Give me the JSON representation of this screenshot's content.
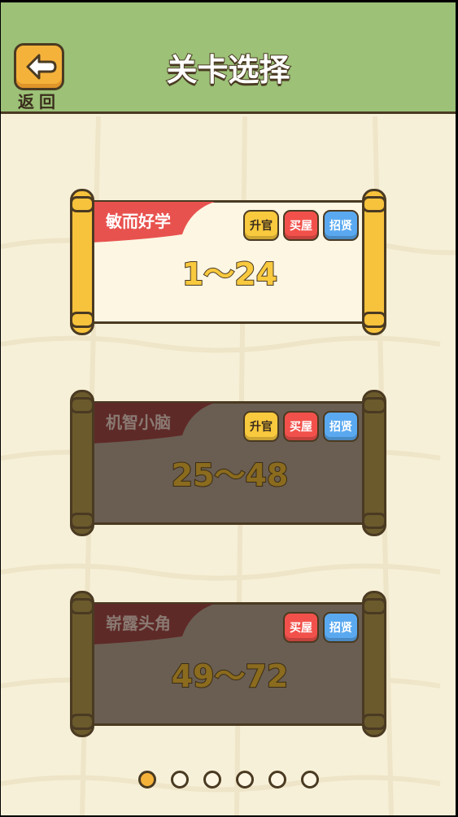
{
  "header": {
    "title": "关卡选择",
    "back_label": "返回"
  },
  "levels": [
    {
      "name": "敏而好学",
      "range": "1～24",
      "locked": false,
      "badges": [
        "升官",
        "买屋",
        "招贤"
      ]
    },
    {
      "name": "机智小脑",
      "range": "25～48",
      "locked": true,
      "badges": [
        "升官",
        "买屋",
        "招贤"
      ]
    },
    {
      "name": "崭露头角",
      "range": "49～72",
      "locked": true,
      "badges": [
        "买屋",
        "招贤"
      ]
    }
  ],
  "pagination": {
    "count": 6,
    "active_index": 0
  },
  "colors": {
    "header_bg": "#9cc177",
    "accent_yellow": "#f9c93e",
    "badge_red": "#f2514b",
    "badge_blue": "#5aa9f0"
  }
}
